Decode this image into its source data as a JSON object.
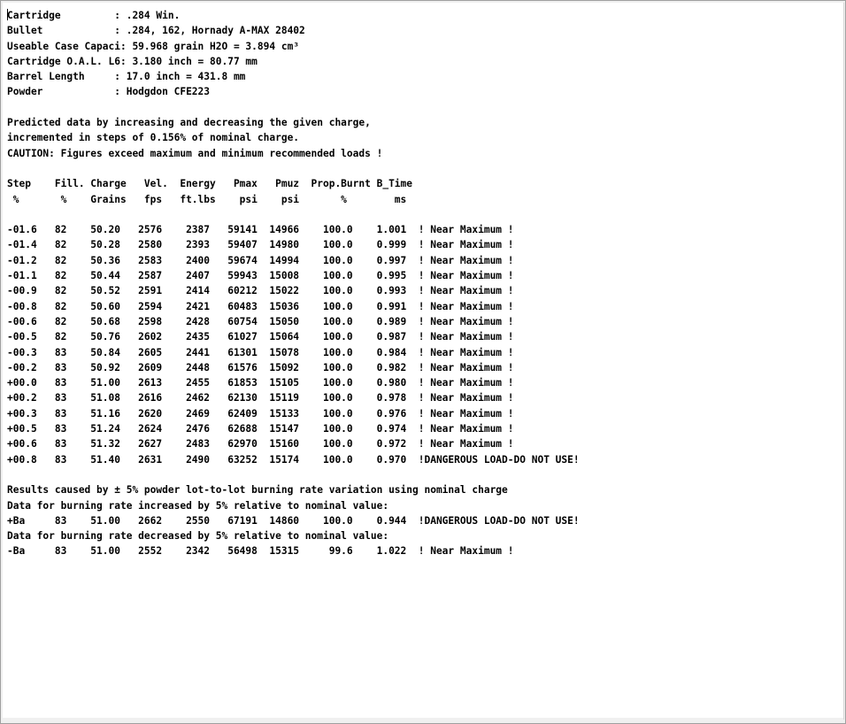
{
  "report": {
    "lines": [
      "Cartridge         : .284 Win.",
      "Bullet            : .284, 162, Hornady A-MAX 28402",
      "Useable Case Capaci: 59.968 grain H2O = 3.894 cm³",
      "Cartridge O.A.L. L6: 3.180 inch = 80.77 mm",
      "Barrel Length     : 17.0 inch = 431.8 mm",
      "Powder            : Hodgdon CFE223",
      "",
      "Predicted data by increasing and decreasing the given charge,",
      "incremented in steps of 0.156% of nominal charge.",
      "CAUTION: Figures exceed maximum and minimum recommended loads !",
      "",
      "Step    Fill. Charge   Vel.  Energy   Pmax   Pmuz  Prop.Burnt B_Time",
      " %       %    Grains   fps   ft.lbs    psi    psi       %        ms",
      "",
      "-01.6   82    50.20   2576    2387   59141  14966    100.0    1.001  ! Near Maximum !",
      "-01.4   82    50.28   2580    2393   59407  14980    100.0    0.999  ! Near Maximum !",
      "-01.2   82    50.36   2583    2400   59674  14994    100.0    0.997  ! Near Maximum !",
      "-01.1   82    50.44   2587    2407   59943  15008    100.0    0.995  ! Near Maximum !",
      "-00.9   82    50.52   2591    2414   60212  15022    100.0    0.993  ! Near Maximum !",
      "-00.8   82    50.60   2594    2421   60483  15036    100.0    0.991  ! Near Maximum !",
      "-00.6   82    50.68   2598    2428   60754  15050    100.0    0.989  ! Near Maximum !",
      "-00.5   82    50.76   2602    2435   61027  15064    100.0    0.987  ! Near Maximum !",
      "-00.3   83    50.84   2605    2441   61301  15078    100.0    0.984  ! Near Maximum !",
      "-00.2   83    50.92   2609    2448   61576  15092    100.0    0.982  ! Near Maximum !",
      "+00.0   83    51.00   2613    2455   61853  15105    100.0    0.980  ! Near Maximum !",
      "+00.2   83    51.08   2616    2462   62130  15119    100.0    0.978  ! Near Maximum !",
      "+00.3   83    51.16   2620    2469   62409  15133    100.0    0.976  ! Near Maximum !",
      "+00.5   83    51.24   2624    2476   62688  15147    100.0    0.974  ! Near Maximum !",
      "+00.6   83    51.32   2627    2483   62970  15160    100.0    0.972  ! Near Maximum !",
      "+00.8   83    51.40   2631    2490   63252  15174    100.0    0.970  !DANGEROUS LOAD-DO NOT USE!",
      "",
      "Results caused by ± 5% powder lot-to-lot burning rate variation using nominal charge",
      "Data for burning rate increased by 5% relative to nominal value:",
      "+Ba     83    51.00   2662    2550   67191  14860    100.0    0.944  !DANGEROUS LOAD-DO NOT USE!",
      "Data for burning rate decreased by 5% relative to nominal value:",
      "-Ba     83    51.00   2552    2342   56498  15315     99.6    1.022  ! Near Maximum !"
    ]
  }
}
